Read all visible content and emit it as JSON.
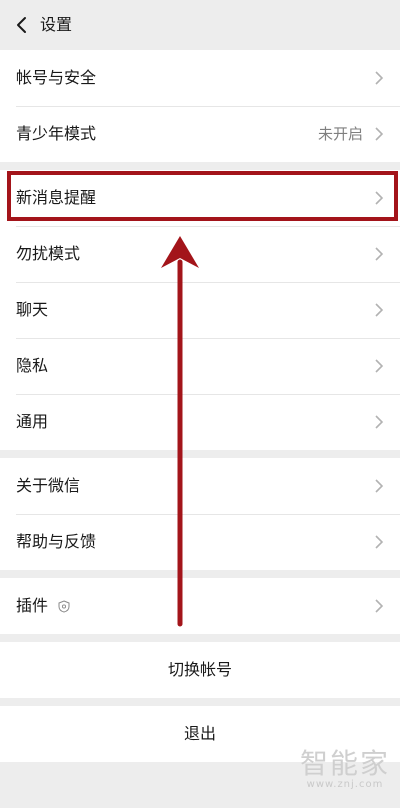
{
  "header": {
    "title": "设置"
  },
  "groups": {
    "account": [
      {
        "label": "帐号与安全"
      },
      {
        "label": "青少年模式",
        "value": "未开启"
      }
    ],
    "settings": [
      {
        "label": "新消息提醒"
      },
      {
        "label": "勿扰模式"
      },
      {
        "label": "聊天"
      },
      {
        "label": "隐私"
      },
      {
        "label": "通用"
      }
    ],
    "about": [
      {
        "label": "关于微信"
      },
      {
        "label": "帮助与反馈"
      }
    ],
    "plugins": [
      {
        "label": "插件"
      }
    ]
  },
  "actions": {
    "switch_account": "切换帐号",
    "logout": "退出"
  },
  "annotation": {
    "color": "#a3141a"
  },
  "watermark": {
    "cn": "智能家",
    "en": "www.znj.com"
  }
}
